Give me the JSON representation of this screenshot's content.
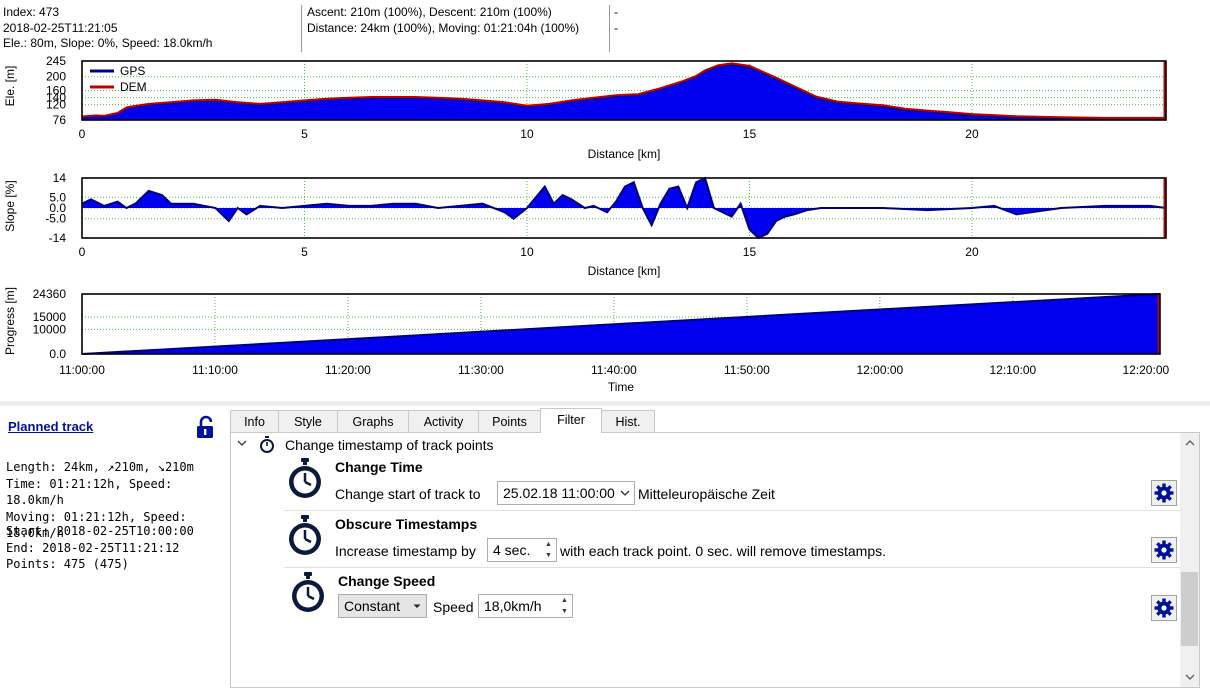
{
  "info": {
    "index": "Index: 473",
    "time": "2018-02-25T11:21:05",
    "point": "Ele.: 80m, Slope: 0%, Speed: 18.0km/h",
    "ascent": "Ascent: 210m (100%), Descent: 210m (100%)",
    "distance": "Distance: 24km (100%), Moving: 01:21:04h (100%)",
    "dash1": "-",
    "dash2": "-"
  },
  "colors": {
    "fill": "#0000ee",
    "gps": "#00007a",
    "dem": "#c00000",
    "grid": "#4db84d",
    "accent": "#00129c"
  },
  "chart_data": [
    {
      "type": "area",
      "ylabel": "Ele. [m]",
      "xlabel": "Distance [km]",
      "ylim": [
        76,
        245
      ],
      "xlim": [
        0,
        24.36
      ],
      "yticks": [
        "245",
        "200",
        "160",
        "140",
        "120",
        "76"
      ],
      "xticks": [
        "0",
        "5",
        "10",
        "15",
        "20"
      ],
      "legend": [
        "GPS",
        "DEM"
      ],
      "legend_position": "top-left",
      "grid": true,
      "x": [
        0,
        0.3,
        0.5,
        0.8,
        1.0,
        1.5,
        2.0,
        2.5,
        3.0,
        3.5,
        4.0,
        4.5,
        5.0,
        5.5,
        6.0,
        6.5,
        7.0,
        7.5,
        8.0,
        8.5,
        9.0,
        9.5,
        10.0,
        10.5,
        11.0,
        11.5,
        12.0,
        12.5,
        13.0,
        13.5,
        13.8,
        14.0,
        14.3,
        14.6,
        15.0,
        15.5,
        16.0,
        16.5,
        17.0,
        17.5,
        18.0,
        18.5,
        19.0,
        19.5,
        20.0,
        21.0,
        22.0,
        23.0,
        24.0,
        24.36
      ],
      "series": [
        {
          "name": "GPS",
          "values": [
            85,
            88,
            87,
            95,
            110,
            120,
            125,
            130,
            132,
            125,
            120,
            125,
            130,
            135,
            138,
            140,
            140,
            140,
            138,
            135,
            130,
            125,
            115,
            120,
            130,
            138,
            145,
            148,
            165,
            185,
            200,
            215,
            230,
            235,
            228,
            200,
            170,
            140,
            125,
            120,
            115,
            105,
            100,
            95,
            90,
            85,
            82,
            80,
            80,
            80
          ]
        },
        {
          "name": "DEM",
          "values": [
            86,
            89,
            88,
            96,
            112,
            122,
            127,
            132,
            134,
            127,
            122,
            127,
            132,
            137,
            140,
            142,
            142,
            142,
            140,
            137,
            132,
            127,
            117,
            122,
            132,
            140,
            147,
            150,
            167,
            187,
            202,
            218,
            233,
            238,
            231,
            203,
            173,
            143,
            128,
            123,
            118,
            108,
            103,
            98,
            93,
            87,
            84,
            82,
            82,
            82
          ]
        }
      ]
    },
    {
      "type": "area",
      "ylabel": "Slope [%]",
      "xlabel": "Distance [km]",
      "ylim": [
        -14,
        14
      ],
      "xlim": [
        0,
        24.36
      ],
      "yticks": [
        "14",
        "5.0",
        "0.0",
        "-5.0",
        "-14"
      ],
      "xticks": [
        "0",
        "5",
        "10",
        "15",
        "20"
      ],
      "grid": true,
      "x": [
        0,
        0.2,
        0.5,
        0.8,
        1.0,
        1.2,
        1.5,
        1.8,
        2.0,
        2.5,
        3.0,
        3.3,
        3.5,
        3.7,
        4.0,
        4.5,
        5.0,
        5.5,
        6.0,
        6.5,
        7.0,
        7.5,
        8.0,
        8.5,
        9.0,
        9.5,
        9.7,
        10.0,
        10.2,
        10.4,
        10.6,
        10.8,
        11.0,
        11.3,
        11.5,
        11.8,
        12.0,
        12.2,
        12.4,
        12.6,
        12.8,
        13.0,
        13.2,
        13.4,
        13.6,
        13.8,
        14.0,
        14.2,
        14.4,
        14.6,
        14.8,
        15.0,
        15.2,
        15.4,
        15.6,
        15.8,
        16.0,
        16.3,
        16.6,
        17.0,
        17.5,
        18.0,
        19.0,
        20.0,
        20.5,
        21.0,
        22.0,
        23.0,
        24.0,
        24.36
      ],
      "series": [
        {
          "name": "Slope",
          "values": [
            2,
            4,
            1,
            3,
            0,
            2,
            8,
            6,
            2,
            2,
            0,
            -6,
            0,
            -3,
            1,
            0,
            1,
            2,
            1,
            1,
            2,
            2,
            0,
            1,
            2,
            -2,
            -5,
            0,
            5,
            10,
            2,
            6,
            4,
            0,
            1,
            -2,
            3,
            10,
            12,
            0,
            -8,
            2,
            9,
            10,
            0,
            12,
            14,
            0,
            -2,
            -4,
            2,
            -10,
            -14,
            -12,
            -6,
            -4,
            -3,
            -1,
            0,
            0,
            0,
            0,
            -1,
            0,
            1,
            -3,
            0,
            1,
            1,
            0
          ]
        }
      ]
    },
    {
      "type": "area",
      "ylabel": "Progress [m]",
      "xlabel": "Time",
      "ylim": [
        0,
        24360
      ],
      "xlim": [
        "11:00:00",
        "12:21:04"
      ],
      "yticks": [
        "24360",
        "15000",
        "10000",
        "0.0"
      ],
      "xticks": [
        "11:00:00",
        "11:10:00",
        "11:20:00",
        "11:30:00",
        "11:40:00",
        "11:50:00",
        "12:00:00",
        "12:10:00",
        "12:20:00"
      ],
      "grid": true,
      "x": [
        "11:00:00",
        "11:21:04",
        "11:42:08",
        "12:03:12",
        "12:21:04"
      ],
      "series": [
        {
          "name": "Progress",
          "values": [
            0,
            6350,
            12700,
            19050,
            24360
          ]
        }
      ]
    }
  ],
  "track": {
    "title": "Planned track",
    "length": "Length: 24km, ↗210m, ↘210m",
    "time": "Time: 01:21:12h, Speed: 18.0km/h",
    "moving": "Moving: 01:21:12h, Speed: 18.0km/h",
    "start": "Start: 2018-02-25T10:00:00",
    "end": "End: 2018-02-25T11:21:12",
    "points": "Points: 475 (475)"
  },
  "tabs": [
    "Info",
    "Style",
    "Graphs",
    "Activity",
    "Points",
    "Filter",
    "Hist."
  ],
  "active_tab": "Filter",
  "filter": {
    "group_title": "Change timestamp of track points",
    "change_time": {
      "title": "Change Time",
      "label": "Change start of track to",
      "value": "25.02.18 11:00:00",
      "zone": "Mitteleuropäische Zeit"
    },
    "obscure": {
      "title": "Obscure Timestamps",
      "label": "Increase timestamp by",
      "value": "4 sec.",
      "suffix": "with each track point. 0 sec. will remove timestamps."
    },
    "speed": {
      "title": "Change Speed",
      "mode": "Constant",
      "label": "Speed",
      "value": "18,0km/h"
    }
  }
}
